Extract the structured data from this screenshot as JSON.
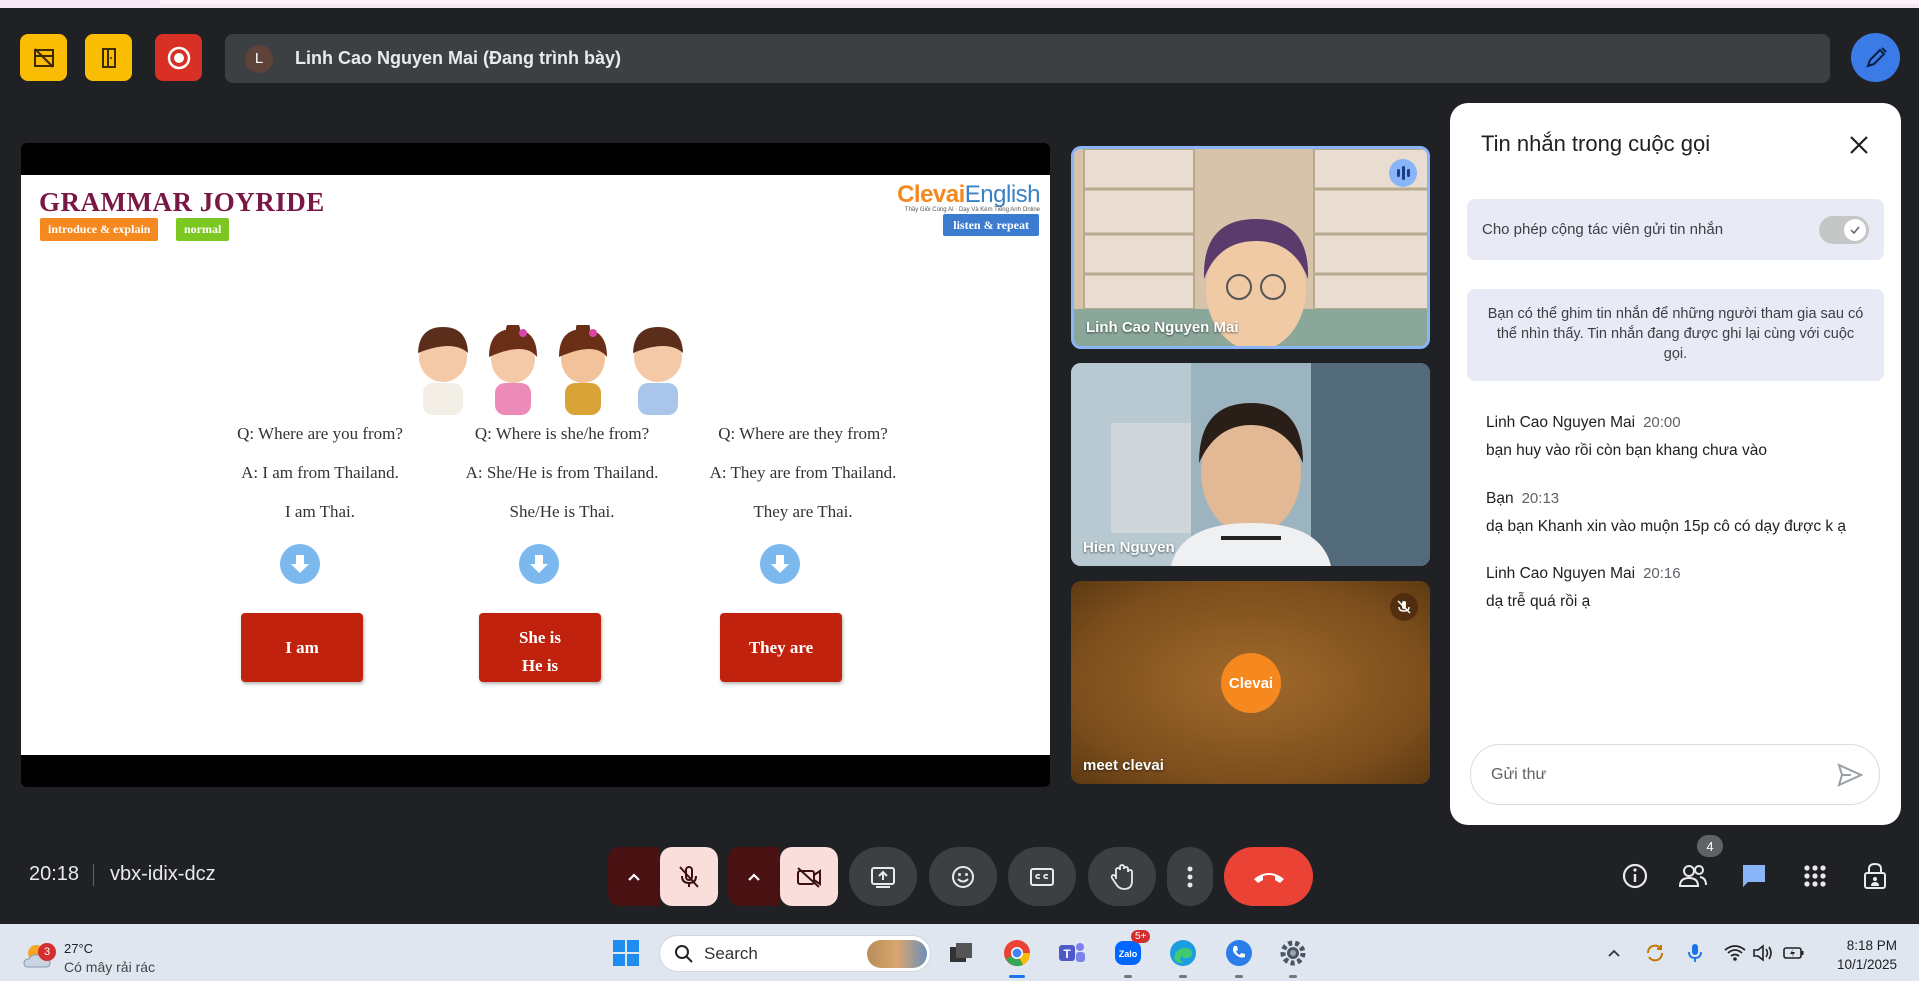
{
  "meeting": {
    "presenter_initial": "L",
    "presenter_label": "Linh Cao Nguyen Mai (Đang trình bày)",
    "time": "20:18",
    "code": "vbx-idix-dcz",
    "people_count": "4"
  },
  "slide": {
    "title": "GRAMMAR JOYRIDE",
    "tag1": "introduce & explain",
    "tag2": "normal",
    "brand_a": "Clevai",
    "brand_b": "English",
    "brand_sub": "Thầy Giỏi Cùng AI · Dạy Và Kèm Tiếng Anh Online",
    "tag3": "listen & repeat",
    "columns": [
      {
        "q": "Q: Where are you from?",
        "a": "A: I am from Thailand.",
        "s": "I am Thai.",
        "btn1": "I am",
        "btn2": ""
      },
      {
        "q": "Q: Where is she/he from?",
        "a": "A: She/He is from Thailand.",
        "s": "She/He is Thai.",
        "btn1": "She is",
        "btn2": "He is"
      },
      {
        "q": "Q: Where are they from?",
        "a": "A: They are from Thailand.",
        "s": "They are Thai.",
        "btn1": "They are",
        "btn2": ""
      }
    ]
  },
  "tiles": [
    {
      "name": "Linh Cao Nguyen Mai"
    },
    {
      "name": "Hien Nguyen"
    },
    {
      "name": "meet clevai",
      "avatar": "Clevai"
    }
  ],
  "chat": {
    "title": "Tin nhắn trong cuộc gọi",
    "allow_label": "Cho phép cộng tác viên gửi tin nhắn",
    "pin_note": "Bạn có thể ghim tin nhắn để những người tham gia sau có thể nhìn thấy. Tin nhắn đang được ghi lại cùng với cuộc gọi.",
    "messages": [
      {
        "sender": "Linh Cao Nguyen Mai",
        "time": "20:00",
        "text": "bạn huy vào rồi còn bạn khang chưa vào"
      },
      {
        "sender": "Bạn",
        "time": "20:13",
        "text": "dạ bạn Khanh xin vào muộn 15p cô có dạy được k ạ"
      },
      {
        "sender": "Linh Cao Nguyen Mai",
        "time": "20:16",
        "text": "dạ trễ quá rồi ạ"
      }
    ],
    "input_placeholder": "Gửi thư"
  },
  "taskbar": {
    "weather_badge": "3",
    "temp": "27°C",
    "weather_desc": "Có mây rải rác",
    "search_placeholder": "Search",
    "zalo_badge": "5+",
    "time": "8:18 PM",
    "date": "10/1/2025"
  },
  "colors": {
    "background": "#202124",
    "accent_blue": "#8ab4f8",
    "end_call": "#ea4335",
    "slide_button": "#c0220d",
    "brand_orange": "#f5891f"
  }
}
